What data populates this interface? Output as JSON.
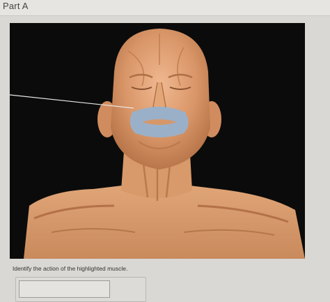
{
  "part": {
    "title": "Part A"
  },
  "figure": {
    "highlight_color": "#9ab0c8",
    "background": "#0b0b0b"
  },
  "question": {
    "prompt": "Identify the action of the highlighted muscle."
  },
  "answer": {
    "value": "",
    "placeholder": ""
  }
}
